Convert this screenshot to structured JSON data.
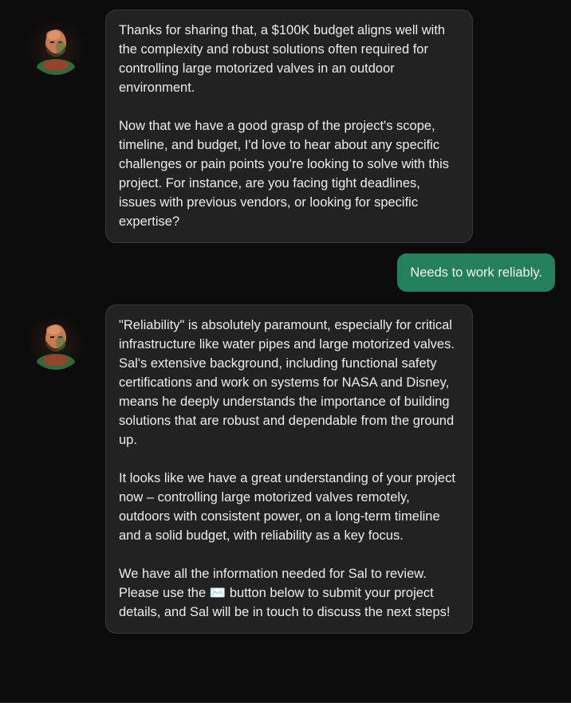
{
  "chat": {
    "messages": [
      {
        "role": "assistant",
        "paragraphs": [
          "Thanks for sharing that, a $100K budget aligns well with the complexity and robust solutions often required for controlling large motorized valves in an outdoor environment.",
          "Now that we have a good grasp of the project's scope, timeline, and budget, I'd love to hear about any specific challenges or pain points you're looking to solve with this project. For instance, are you facing tight deadlines, issues with previous vendors, or looking for specific expertise?"
        ]
      },
      {
        "role": "user",
        "text": "Needs to work reliably."
      },
      {
        "role": "assistant",
        "paragraphs": [
          "\"Reliability\" is absolutely paramount, especially for critical infrastructure like water pipes and large motorized valves. Sal's extensive background, including functional safety certifications and work on systems for NASA and Disney, means he deeply understands the importance of building solutions that are robust and dependable from the ground up.",
          "It looks like we have a great understanding of your project now – controlling large motorized valves remotely, outdoors with consistent power, on a long-term timeline and a solid budget, with reliability as a key focus.",
          "We have all the information needed for Sal to review. Please use the ✉️ button below to submit your project details, and Sal will be in touch to discuss the next steps!"
        ]
      }
    ]
  },
  "colors": {
    "background": "#0c0c0c",
    "bot_bubble": "#222222",
    "user_bubble": "#24805c",
    "text": "#ececec"
  },
  "icons": {
    "assistant_avatar": "assistant-avatar-portrait"
  }
}
